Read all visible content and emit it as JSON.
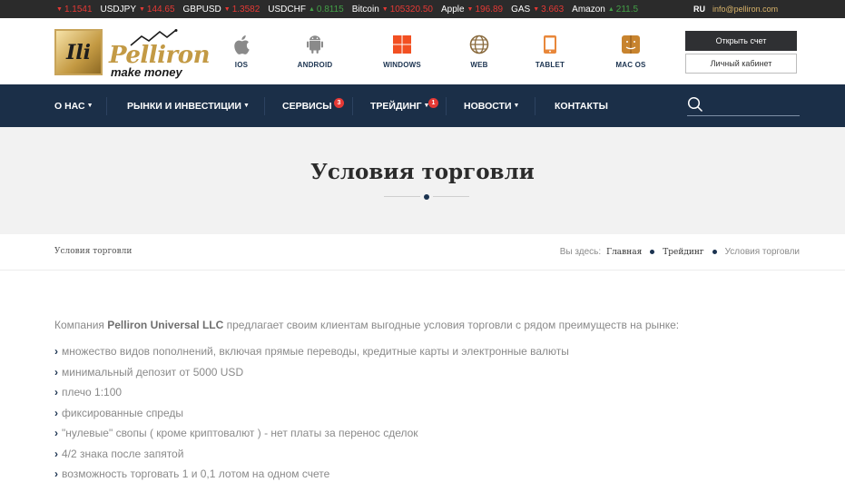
{
  "ticker": {
    "items": [
      {
        "symbol": "",
        "value": "1.1541",
        "dir": "down"
      },
      {
        "symbol": "USDJPY",
        "value": "144.65",
        "dir": "down"
      },
      {
        "symbol": "GBPUSD",
        "value": "1.3582",
        "dir": "down"
      },
      {
        "symbol": "USDCHF",
        "value": "0.8115",
        "dir": "up"
      },
      {
        "symbol": "Bitcoin",
        "value": "105320.50",
        "dir": "down"
      },
      {
        "symbol": "Apple",
        "value": "196.89",
        "dir": "down"
      },
      {
        "symbol": "GAS",
        "value": "3.663",
        "dir": "down"
      },
      {
        "symbol": "Amazon",
        "value": "211.5",
        "dir": "up"
      }
    ],
    "lang": "RU",
    "email": "info@pelliron.com"
  },
  "logo": {
    "mark": "Ili",
    "name": "Pelliron",
    "tagline": "make money"
  },
  "platforms": [
    {
      "label": "IOS",
      "icon": "apple-icon"
    },
    {
      "label": "ANDROID",
      "icon": "android-icon"
    },
    {
      "label": "WINDOWS",
      "icon": "windows-icon"
    },
    {
      "label": "WEB",
      "icon": "globe-icon"
    },
    {
      "label": "TABLET",
      "icon": "tablet-icon"
    },
    {
      "label": "MAC OS",
      "icon": "macos-icon"
    }
  ],
  "header": {
    "open_account": "Открыть счет",
    "cabinet": "Личный кабинет"
  },
  "nav": [
    {
      "label": "О НАС",
      "caret": true,
      "badge": ""
    },
    {
      "label": "РЫНКИ И ИНВЕСТИЦИИ",
      "caret": true,
      "badge": ""
    },
    {
      "label": "СЕРВИСЫ",
      "caret": true,
      "badge": "3"
    },
    {
      "label": "ТРЕЙДИНГ",
      "caret": true,
      "badge": "1"
    },
    {
      "label": "НОВОСТИ",
      "caret": true,
      "badge": ""
    },
    {
      "label": "КОНТАКТЫ",
      "caret": false,
      "badge": ""
    }
  ],
  "search": {
    "value": "",
    "placeholder": ""
  },
  "page": {
    "title": "Условия торговли"
  },
  "breadcrumb": {
    "left": "Условия торговли",
    "prefix": "Вы здесь:",
    "home": "Главная",
    "section": "Трейдинг",
    "current": "Условия торговли"
  },
  "content": {
    "intro_before": "Компания ",
    "intro_company": "Pelliron Universal LLC",
    "intro_after": " предлагает своим клиентам выгодные условия торговли с рядом преимуществ на рынке:",
    "bullets": [
      "множество видов пополнений, включая прямые переводы, кредитные карты и электронные валюты",
      "минимальный депозит от 5000 USD",
      "плечо 1:100",
      "фиксированные спреды",
      "\"нулевые\" свопы ( кроме криптовалют ) - нет платы за перенос сделок",
      "4/2 знака после запятой",
      "возможность торговать 1 и 0,1 лотом на одном счете"
    ]
  },
  "colors": {
    "nav_bg": "#1b2f48",
    "gold": "#c39a45",
    "down": "#e53935",
    "up": "#43a047"
  }
}
